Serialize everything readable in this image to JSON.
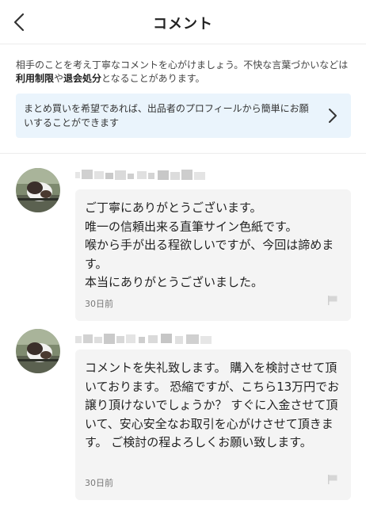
{
  "header": {
    "title": "コメント"
  },
  "notice": {
    "text_before": "相手のことを考え丁寧なコメントを心がけましょう。不快な言葉づかいなどは",
    "bold1": "利用制限",
    "text_mid": "や",
    "bold2": "退会処分",
    "text_after": "となることがあります。"
  },
  "banner": {
    "text": "まとめ買いを希望であれば、出品者のプロフィールから簡単にお願いすることができます"
  },
  "comments": [
    {
      "text": "ご丁寧にありがとうございます。\n唯一の信頼出来る直筆サイン色紙です。\n喉から手が出る程欲しいですが、今回は諦めます。\n本当にありがとうございました。",
      "time": "30日前"
    },
    {
      "text": "コメントを失礼致します。 購入を検討させて頂いております。 恐縮ですが、こちら13万円でお譲り頂けないでしょうか？ すぐに入金させて頂いて、安心安全なお取引を心がけさせて頂きます。 ご検討の程よろしくお願い致します。",
      "time": "30日前"
    }
  ],
  "icons": {
    "back": "chevron-left-icon",
    "banner_arrow": "chevron-right-icon",
    "report": "flag-icon"
  },
  "colors": {
    "banner_bg": "#eaf4fc",
    "bubble_bg": "#f4f4f4"
  }
}
